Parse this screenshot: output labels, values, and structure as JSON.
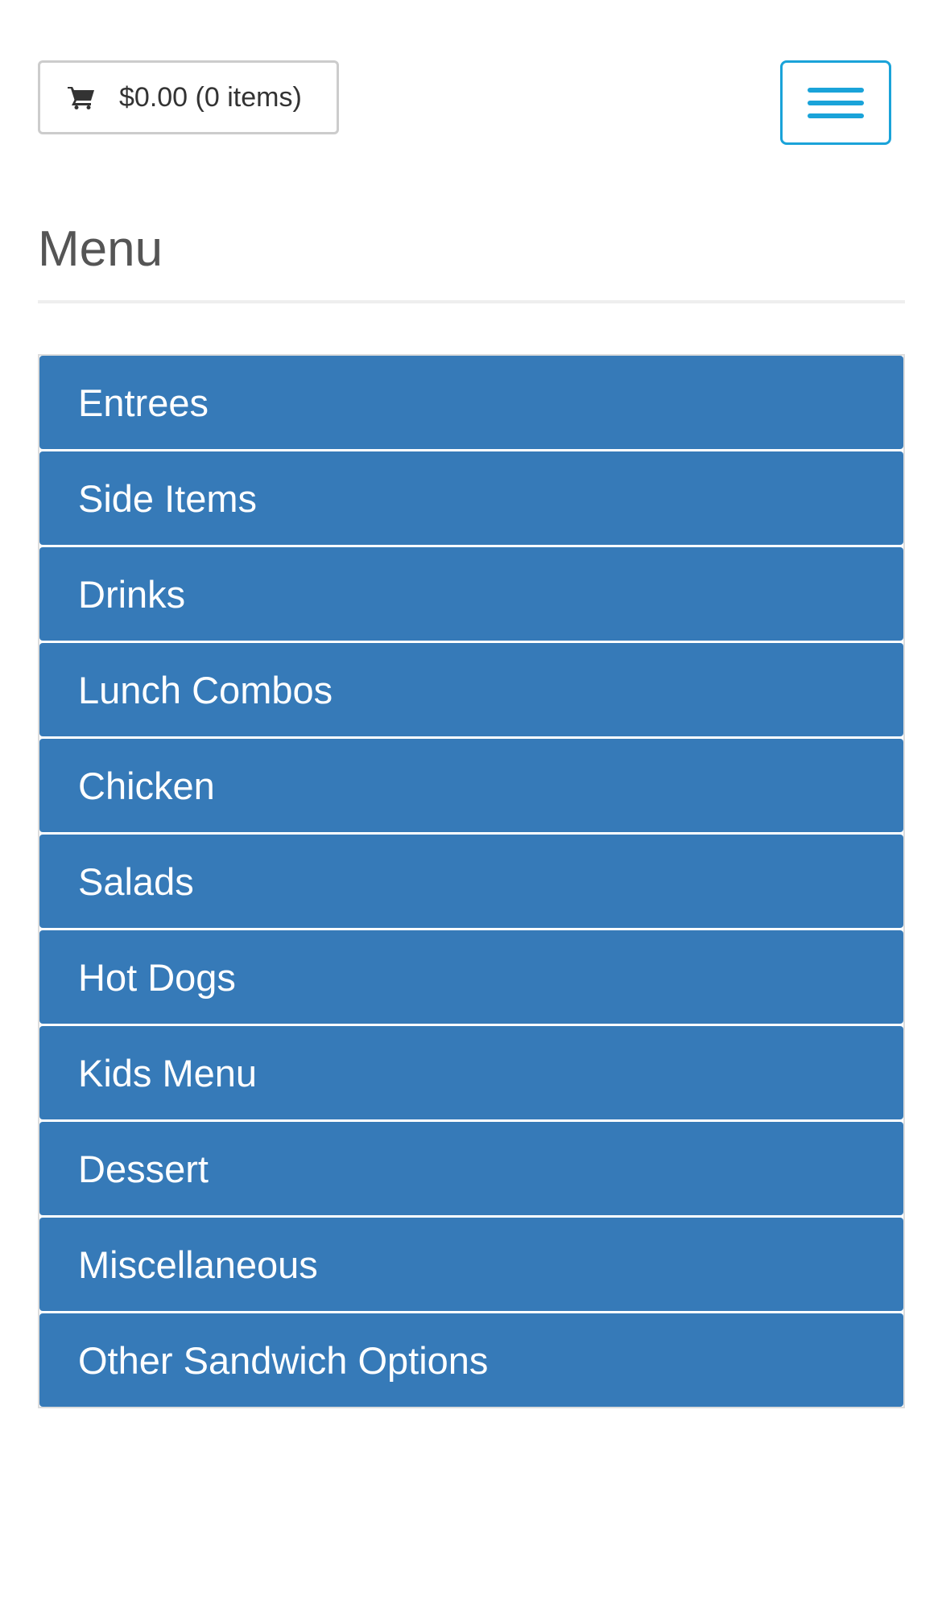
{
  "header": {
    "cart": {
      "icon": "cart-icon",
      "label": "$0.00 (0 items)"
    },
    "nav_toggle": {
      "icon": "hamburger-menu-icon",
      "color": "#1aa3d9"
    }
  },
  "main": {
    "title": "Menu",
    "categories": [
      {
        "label": "Entrees"
      },
      {
        "label": "Side Items"
      },
      {
        "label": "Drinks"
      },
      {
        "label": "Lunch Combos"
      },
      {
        "label": "Chicken"
      },
      {
        "label": "Salads"
      },
      {
        "label": "Hot Dogs"
      },
      {
        "label": "Kids Menu"
      },
      {
        "label": "Dessert"
      },
      {
        "label": "Miscellaneous"
      },
      {
        "label": "Other Sandwich Options"
      }
    ]
  },
  "colors": {
    "category_background": "#367ab8",
    "category_text": "#ffffff",
    "accent": "#1aa3d9"
  }
}
